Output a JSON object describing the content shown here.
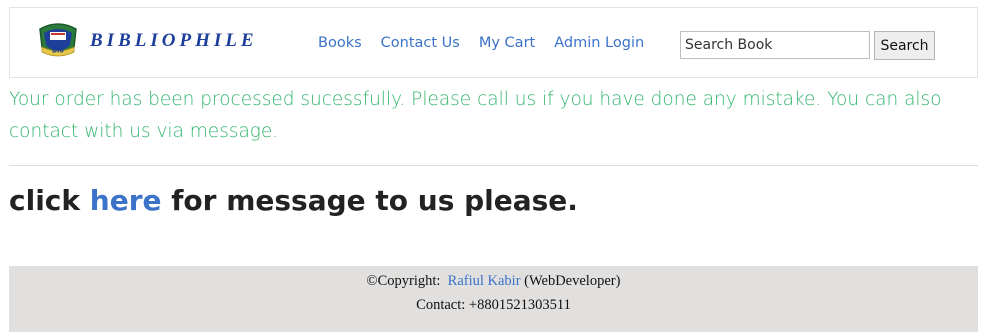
{
  "brand": {
    "name": "BIBLIOPHILE",
    "logo_text": "DIU",
    "logo_icon": "university-crest-icon"
  },
  "nav": {
    "items": [
      {
        "label": "Books"
      },
      {
        "label": "Contact Us"
      },
      {
        "label": "My Cart"
      },
      {
        "label": "Admin Login"
      }
    ]
  },
  "search": {
    "placeholder": "Search Book",
    "button_label": "Search"
  },
  "message": {
    "text": "Your order has been processed sucessfully. Please call us if you have done any mistake. You can also contact with us via message."
  },
  "cta": {
    "before": "click ",
    "link": "here",
    "after": " for message to us please."
  },
  "footer": {
    "copyright_label": "©Copyright:",
    "author": "Rafiul Kabir",
    "author_role": "(WebDeveloper)",
    "contact": "Contact: +8801521303511"
  },
  "colors": {
    "accent_link": "#3b73c9",
    "brand_text": "#1d3f9a",
    "success_text": "#35b56f",
    "footer_bg": "#e2e0df"
  }
}
